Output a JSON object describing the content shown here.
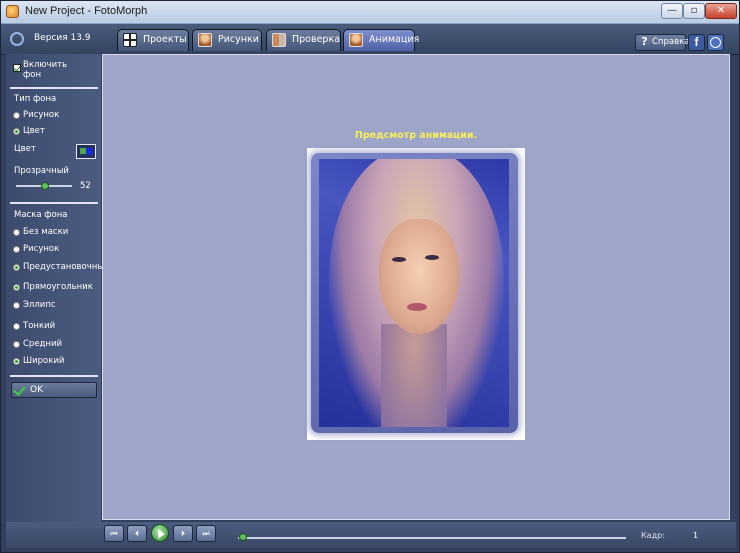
{
  "window": {
    "title": "New Project - FotoMorph",
    "min_glyph": "—",
    "max_glyph": "▫",
    "close_glyph": "✕"
  },
  "toolbar": {
    "version": "Версия 13.9",
    "tabs": [
      {
        "label": "Проекты",
        "icon": "grid-icon",
        "active": false
      },
      {
        "label": "Рисунки",
        "icon": "photo-icon",
        "active": false
      },
      {
        "label": "Проверка",
        "icon": "compare-icon",
        "active": false
      },
      {
        "label": "Анимация",
        "icon": "animation-icon",
        "active": true
      }
    ],
    "help_label": "Справка",
    "help_glyph": "?",
    "facebook_glyph": "f"
  },
  "sidebar": {
    "enable_bg_line1": "Включить",
    "enable_bg_line2": "фон",
    "bg_type_label": "Тип фона",
    "bg_options": [
      "Рисунок",
      "Цвет"
    ],
    "bg_selected": "Цвет",
    "color_label": "Цвет",
    "transparency_label": "Прозрачный",
    "transparency_value": "52",
    "mask_label": "Маска фона",
    "mask_options": [
      "Без маски",
      "Рисунок",
      "Предустановочный"
    ],
    "mask_selected": "Предустановочный",
    "shape_options": [
      "Прямоугольник",
      "Эллипс"
    ],
    "shape_selected": "Прямоугольник",
    "width_options": [
      "Тонкий",
      "Средний",
      "Широкий"
    ],
    "width_selected": "Широкий",
    "ok_label": "OK"
  },
  "main": {
    "preview_title": "Предсмотр анимации."
  },
  "playback": {
    "frame_label": "Кадр:",
    "frame_value": "1",
    "first_glyph": "⏮",
    "prev_glyph": "⏴",
    "next_glyph": "⏵",
    "last_glyph": "⏭"
  },
  "colors": {
    "background": "#9da5c8",
    "accent_title": "#f8ee5a",
    "active_tab": "#6070b8"
  }
}
